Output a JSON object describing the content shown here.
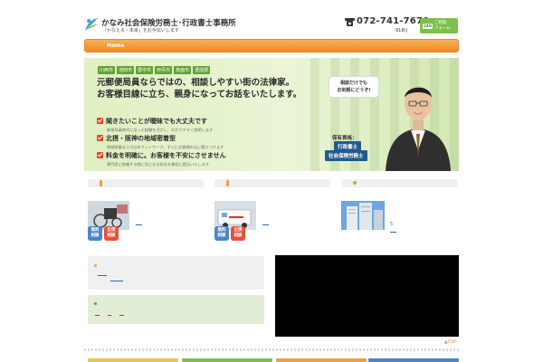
{
  "header": {
    "site_title": "かなみ社会保険労務士･行政書士事務所",
    "tagline": "「かなえる・未来」をお手伝いします",
    "phone_number": "072-741-7670",
    "phone_sub": "918()",
    "contact_badge": "24H",
    "contact_label": "ご相談\nフォーム"
  },
  "nav": {
    "home_label": "Home"
  },
  "hero": {
    "cities": [
      "川西市",
      "池田市",
      "豊中市",
      "伊丹市",
      "箕面市",
      "豊能郡"
    ],
    "headline_1": "元郵便局員ならではの、相談しやすい街の法律家。",
    "headline_2": "お客様目線に立ち、親身になってお話をいたします。",
    "features": [
      {
        "title": "聞きたいことが曖昧でも大丈夫です",
        "desc": "郵便局員時代に培った経験を活かし、わかりやすく説明します"
      },
      {
        "title": "北摂・阪神の地域密着型",
        "desc": "地域密着ならではのフットワーク。すぐにお客様の元に駆けつけます"
      },
      {
        "title": "料金を明確に。お客様を不安にさせません",
        "desc": "専門家に依頼する際に気になる料金を最初に提示いたします"
      }
    ],
    "bubble_text": "相談だけでも\nお気軽にどうぞ!",
    "qualification_label": "保有資格：",
    "qualifications": [
      "行政書士",
      "社会保険労務士"
    ]
  },
  "services": {
    "col1_pill_a": "無料\n相談",
    "col1_pill_b": "出張\n相談",
    "col2_pill_a": "無料\n相談",
    "col2_pill_b": "出張\n相談",
    "col3_caption": "5"
  },
  "footer": {
    "to_top": "▲TOP"
  },
  "colors": {
    "nav_orange": "#ee8a1f",
    "accent_green": "#5fa32e",
    "badge_blue": "#215b8c",
    "link_blue": "#2c63b8",
    "check_red": "#e8442a"
  }
}
